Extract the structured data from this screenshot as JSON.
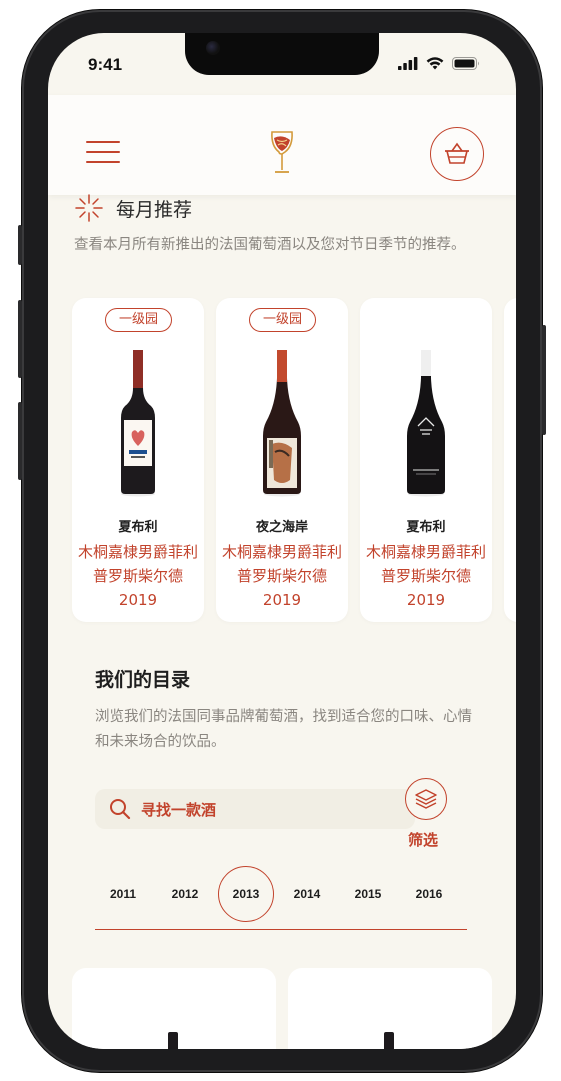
{
  "status": {
    "time": "9:41"
  },
  "monthly": {
    "title": "每月推荐",
    "description": "查看本月所有新推出的法国葡萄酒以及您对节日季节的推荐。"
  },
  "wines": [
    {
      "badge": "一级园",
      "name": "夏布利",
      "desc": "木桐嘉棣男爵菲利普罗斯柴尔德 2019"
    },
    {
      "badge": "一级园",
      "name": "夜之海岸",
      "desc": "木桐嘉棣男爵菲利普罗斯柴尔德 2019"
    },
    {
      "badge": "",
      "name": "夏布利",
      "desc": "木桐嘉棣男爵菲利普罗斯柴尔德 2019"
    }
  ],
  "catalog": {
    "title": "我们的目录",
    "description": "浏览我们的法国同事品牌葡萄酒，找到适合您的口味、心情和未来场合的饮品。",
    "search_placeholder": "寻找一款酒",
    "filter_label": "筛选"
  },
  "years": {
    "items": [
      "2011",
      "2012",
      "2013",
      "2014",
      "2015",
      "2016"
    ],
    "selected": "2013"
  },
  "colors": {
    "accent": "#c2432c",
    "background": "#f8f6ef",
    "card": "#ffffff"
  },
  "icons": {
    "menu": "hamburger-menu-icon",
    "logo": "wine-glass-logo",
    "cart": "basket-icon",
    "sparkle": "sparkle-icon",
    "search": "search-icon",
    "filter": "layers-icon"
  }
}
